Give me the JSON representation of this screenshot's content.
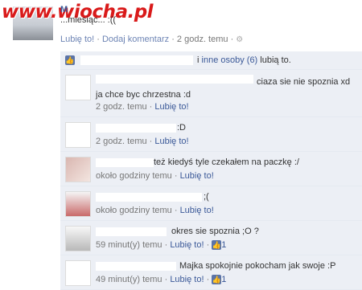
{
  "watermark": "www.wiocha.pl",
  "post": {
    "name": "M",
    "text": "...miesiąc... :((",
    "meta": {
      "like": "Lubię to!",
      "sep1": " · ",
      "comment": "Dodaj komentarz",
      "sep2": " · ",
      "time": "2 godz. temu",
      "sep3": " · "
    }
  },
  "likes": {
    "prefix": "i",
    "others": "inne osoby (6)",
    "suffix": "lubią to."
  },
  "comments": [
    {
      "text": "ciaza sie nie spoznia xd ja chce byc chrzestna :d",
      "time": "2 godz. temu",
      "like": "Lubię to!",
      "count": ""
    },
    {
      "text": ":D",
      "time": "2 godz. temu",
      "like": "Lubię to!",
      "count": ""
    },
    {
      "text": "też kiedyś tyle czekałem na paczkę :/",
      "time": "około godziny temu",
      "like": "Lubię to!",
      "count": ""
    },
    {
      "text": ";(",
      "time": "około godziny temu",
      "like": "Lubię to!",
      "count": ""
    },
    {
      "text": "okres sie spoznia ;O ?",
      "time": "59 minut(y) temu",
      "like": "Lubię to!",
      "count": "1"
    },
    {
      "text": "Majka spokojnie pokocham jak swoje :P",
      "time": "49 minut(y) temu",
      "like": "Lubię to!",
      "count": "1"
    }
  ]
}
